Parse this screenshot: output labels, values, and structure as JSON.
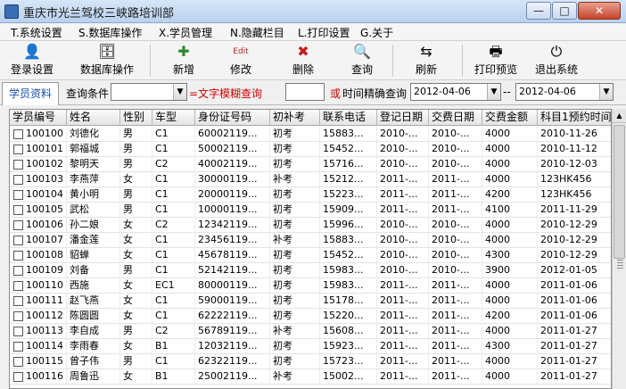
{
  "window": {
    "title": "重庆市光兰驾校三峡路培训部",
    "min": "—",
    "max": "□",
    "close": "✕"
  },
  "menu": [
    "T.系统设置",
    "S.数据库操作",
    "X.学员管理",
    "N.隐藏栏目",
    "L.打印设置",
    "G.关于"
  ],
  "toolbar": {
    "login": "登录设置",
    "db": "数据库操作",
    "new": "新增",
    "edit": "修改",
    "delete": "删除",
    "query": "查询",
    "refresh": "刷新",
    "preview": "打印预览",
    "exit": "退出系统",
    "edit_icon_text": "Edit"
  },
  "query": {
    "tab": "学员资料",
    "condition_label": "查询条件",
    "condition_value": "",
    "fuzzy_label": "=文字模糊查询",
    "or": "或",
    "time_label": "时间精确查询",
    "date_from": "2012-04-06",
    "date_sep": "--",
    "date_to": "2012-04-06"
  },
  "table": {
    "headers": [
      "学员编号",
      "姓名",
      "性别",
      "车型",
      "身份证号码",
      "初补考",
      "联系电话",
      "登记日期",
      "交费日期",
      "交费金额",
      "科目1预约时间"
    ],
    "rows": [
      [
        "100100",
        "刘德化",
        "男",
        "C1",
        "60002119...",
        "初考",
        "15883...",
        "2010-...",
        "2010-...",
        "4000",
        "2010-11-26"
      ],
      [
        "100101",
        "郭福城",
        "男",
        "C1",
        "50002119...",
        "初考",
        "15452...",
        "2010-...",
        "2010-...",
        "4000",
        "2010-11-12"
      ],
      [
        "100102",
        "黎明天",
        "男",
        "C2",
        "40002119...",
        "初考",
        "15716...",
        "2010-...",
        "2010-...",
        "4000",
        "2010-12-03"
      ],
      [
        "100103",
        "李燕萍",
        "女",
        "C1",
        "30000119...",
        "补考",
        "15212...",
        "2011-...",
        "2011-...",
        "4000",
        "123HK456"
      ],
      [
        "100104",
        "黄小明",
        "男",
        "C1",
        "20000119...",
        "初考",
        "15223...",
        "2011-...",
        "2011-...",
        "4200",
        "123HK456"
      ],
      [
        "100105",
        "武松",
        "男",
        "C1",
        "10000119...",
        "初考",
        "15909...",
        "2011-...",
        "2011-...",
        "4100",
        "2011-11-29"
      ],
      [
        "100106",
        "孙二娘",
        "女",
        "C2",
        "12342119...",
        "初考",
        "15996...",
        "2010-...",
        "2010-...",
        "4000",
        "2010-12-29"
      ],
      [
        "100107",
        "潘金莲",
        "女",
        "C1",
        "23456119...",
        "补考",
        "15883...",
        "2010-...",
        "2010-...",
        "4000",
        "2010-12-29"
      ],
      [
        "100108",
        "貂蝉",
        "女",
        "C1",
        "45678119...",
        "初考",
        "15452...",
        "2010-...",
        "2010-...",
        "4300",
        "2010-12-29"
      ],
      [
        "100109",
        "刘备",
        "男",
        "C1",
        "52142119...",
        "初考",
        "15983...",
        "2010-...",
        "2010-...",
        "3900",
        "2012-01-05"
      ],
      [
        "100110",
        "西施",
        "女",
        "EC1",
        "80000119...",
        "初考",
        "15983...",
        "2011-...",
        "2011-...",
        "4000",
        "2011-01-06"
      ],
      [
        "100111",
        "赵飞燕",
        "女",
        "C1",
        "59000119...",
        "初考",
        "15178...",
        "2011-...",
        "2011-...",
        "4000",
        "2011-01-06"
      ],
      [
        "100112",
        "陈圆圆",
        "女",
        "C1",
        "62222119...",
        "初考",
        "15220...",
        "2011-...",
        "2011-...",
        "4200",
        "2011-01-06"
      ],
      [
        "100113",
        "李自成",
        "男",
        "C2",
        "56789119...",
        "补考",
        "15608...",
        "2011-...",
        "2011-...",
        "4000",
        "2011-01-27"
      ],
      [
        "100114",
        "李雨春",
        "女",
        "B1",
        "12032119...",
        "初考",
        "15923...",
        "2011-...",
        "2011-...",
        "4300",
        "2011-01-27"
      ],
      [
        "100115",
        "曾子伟",
        "男",
        "C1",
        "62322119...",
        "初考",
        "15723...",
        "2011-...",
        "2011-...",
        "4000",
        "2011-01-27"
      ],
      [
        "100116",
        "周鲁迅",
        "女",
        "B1",
        "25002119...",
        "补考",
        "15002...",
        "2011-...",
        "2011-...",
        "4000",
        "2011-01-27"
      ]
    ]
  }
}
